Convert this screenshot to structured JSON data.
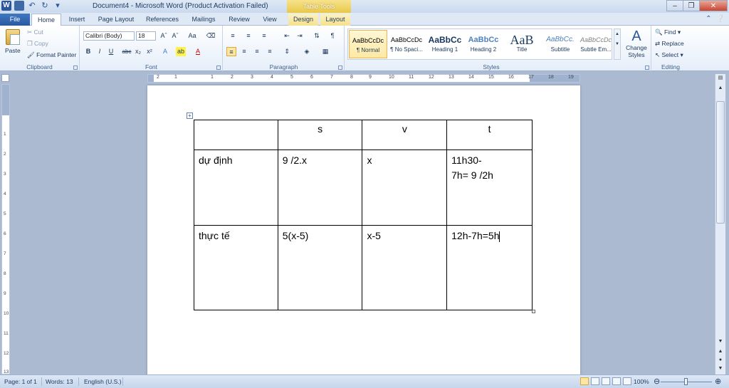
{
  "titlebar": {
    "title": "Document4  -  Microsoft Word (Product Activation Failed)",
    "context_tab": "Table Tools",
    "app_logo": "W"
  },
  "tabs": {
    "file": "File",
    "home": "Home",
    "insert": "Insert",
    "page_layout": "Page Layout",
    "references": "References",
    "mailings": "Mailings",
    "review": "Review",
    "view": "View",
    "design": "Design",
    "layout": "Layout"
  },
  "clipboard": {
    "paste": "Paste",
    "cut": "Cut",
    "copy": "Copy",
    "format_painter": "Format Painter",
    "label": "Clipboard"
  },
  "font": {
    "name": "Calibri (Body)",
    "size": "18",
    "label": "Font"
  },
  "paragraph": {
    "label": "Paragraph"
  },
  "styles": {
    "label": "Styles",
    "items": [
      {
        "sample": "AaBbCcDc",
        "name": "¶ Normal"
      },
      {
        "sample": "AaBbCcDc",
        "name": "¶ No Spaci..."
      },
      {
        "sample": "AaBbCc",
        "name": "Heading 1"
      },
      {
        "sample": "AaBbCc",
        "name": "Heading 2"
      },
      {
        "sample": "AaB",
        "name": "Title"
      },
      {
        "sample": "AaBbCc.",
        "name": "Subtitle"
      },
      {
        "sample": "AaBbCcDc",
        "name": "Subtle Em..."
      }
    ],
    "change_styles": "Change Styles"
  },
  "editing": {
    "find": "Find",
    "replace": "Replace",
    "select": "Select",
    "label": "Editing"
  },
  "table": {
    "rows": [
      [
        "",
        "s",
        "v",
        "t"
      ],
      [
        "dự định",
        [
          "9 /2.x"
        ],
        [
          "x"
        ],
        [
          "11h30-",
          "7h= 9 /2h"
        ]
      ],
      [
        "thực tế",
        [
          "5(x-5)"
        ],
        [
          "x-5"
        ],
        [
          "12h-7h=5h"
        ]
      ]
    ],
    "header": {
      "c0": "",
      "c1": "s",
      "c2": "v",
      "c3": "t"
    },
    "r1": {
      "c0": "dự định",
      "c1": "9 /2.x",
      "c2": "x",
      "c3_line1": "11h30-",
      "c3_line2": "7h= 9 /2h"
    },
    "r2": {
      "c0": "thực tế",
      "c1": "5(x-5)",
      "c2": "x-5",
      "c3": "12h-7h=5h"
    }
  },
  "statusbar": {
    "page": "Page: 1 of 1",
    "words": "Words: 13",
    "language": "English (U.S.)",
    "zoom": "100%"
  },
  "ruler": {
    "h_ticks": [
      "2",
      "1",
      "1",
      "2",
      "3",
      "4",
      "5",
      "6",
      "7",
      "8",
      "9",
      "10",
      "11",
      "12",
      "13",
      "14",
      "15",
      "16",
      "17",
      "18",
      "19"
    ],
    "v_ticks": [
      "1",
      "2",
      "3",
      "4",
      "5",
      "6",
      "7",
      "8",
      "9",
      "10",
      "11",
      "12",
      "13"
    ]
  }
}
